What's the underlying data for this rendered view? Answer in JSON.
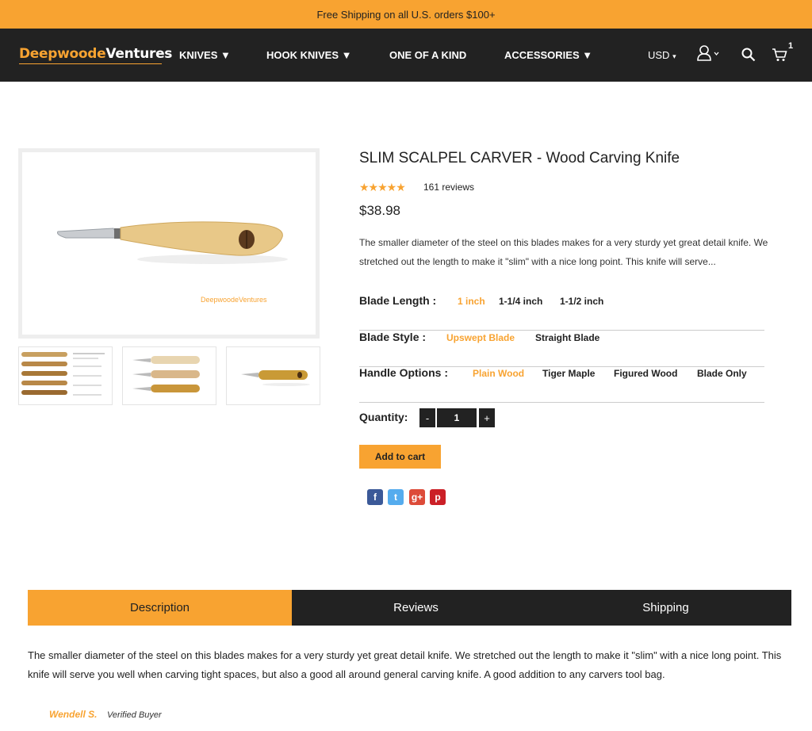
{
  "promo": {
    "text": "Free Shipping on all U.S. orders $100+"
  },
  "header": {
    "logo_part1": "Deepwoode",
    "logo_part2": "Ventures",
    "nav": [
      {
        "label": "KNIVES ▼"
      },
      {
        "label": "HOOK KNIVES ▼"
      },
      {
        "label": "ONE OF A KIND"
      },
      {
        "label": "ACCESSORIES ▼"
      }
    ],
    "currency": "USD",
    "cart_count": "1",
    "icons": [
      "user-icon",
      "search-icon",
      "cart-icon"
    ]
  },
  "product": {
    "image_watermark": "DeepwoodeVentures",
    "title": "SLIM SCALPEL CARVER - Wood Carving Knife",
    "rating_stars": 5,
    "reviews_count": "161 reviews",
    "price": "$38.98",
    "short_description": "The smaller diameter of the steel on this blades makes for a very sturdy yet great detail knife. We stretched out the length to make it \"slim\" with a nice long point. This knife will serve...",
    "options": {
      "blade_length": {
        "label": "Blade Length :",
        "values": [
          "1 inch",
          "1-1/4 inch",
          "1-1/2 inch"
        ],
        "selected": "1 inch"
      },
      "blade_style": {
        "label": "Blade Style :",
        "values": [
          "Upswept Blade",
          "Straight Blade"
        ],
        "selected": "Upswept Blade"
      },
      "handle_options": {
        "label": "Handle Options :",
        "values": [
          "Plain Wood",
          "Tiger Maple",
          "Figured Wood",
          "Blade Only"
        ],
        "selected": "Plain Wood"
      }
    },
    "quantity_label": "Quantity:",
    "quantity": "1",
    "minus": "-",
    "plus": "+",
    "add_to_cart": "Add to cart",
    "share": [
      {
        "name": "facebook",
        "glyph": "f",
        "color": "#3b5998"
      },
      {
        "name": "twitter",
        "glyph": "t",
        "color": "#55acee"
      },
      {
        "name": "google-plus",
        "glyph": "g+",
        "color": "#dd4b39"
      },
      {
        "name": "pinterest",
        "glyph": "p",
        "color": "#cb2027"
      }
    ]
  },
  "tabs": [
    {
      "label": "Description",
      "active": true
    },
    {
      "label": "Reviews",
      "active": false
    },
    {
      "label": "Shipping",
      "active": false
    }
  ],
  "description": {
    "text": "The smaller diameter of the steel on this blades makes for a very sturdy yet great detail knife. We stretched out the length to make it \"slim\" with a nice long point. This knife will serve you well when carving tight spaces, but also a good all around general carving knife. A good addition to any carvers tool bag."
  },
  "review": {
    "author": "Wendell S.",
    "badge": "Verified Buyer"
  },
  "colors": {
    "accent": "#f8a331",
    "dark": "#222222"
  }
}
